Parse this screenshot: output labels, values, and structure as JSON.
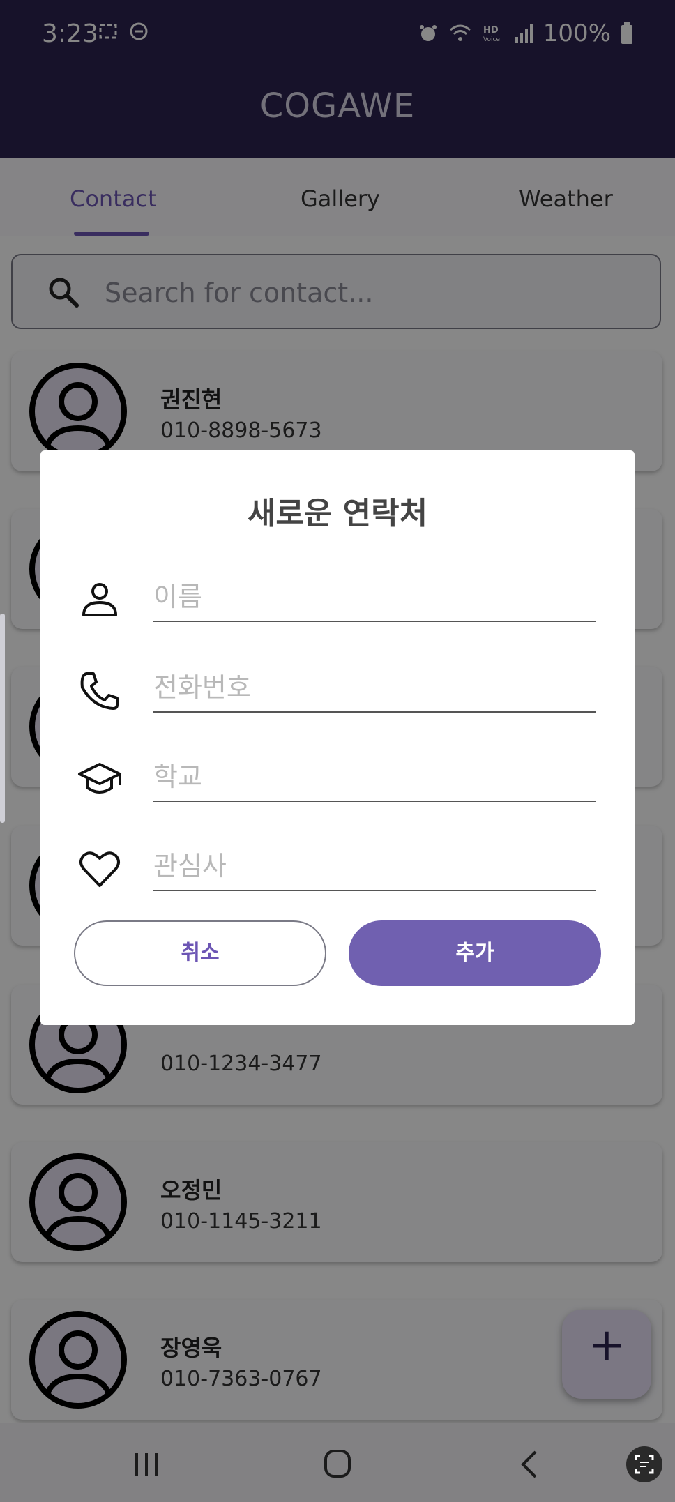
{
  "status_bar": {
    "time": "3:23",
    "battery": "100%"
  },
  "app": {
    "title": "COGAWE"
  },
  "tabs": [
    {
      "label": "Contact",
      "active": true
    },
    {
      "label": "Gallery",
      "active": false
    },
    {
      "label": "Weather",
      "active": false
    }
  ],
  "search": {
    "placeholder": "Search for contact..."
  },
  "contacts": [
    {
      "name": "권진현",
      "phone": "010-8898-5673"
    },
    {
      "name": "",
      "phone": ""
    },
    {
      "name": "",
      "phone": ""
    },
    {
      "name": "",
      "phone": ""
    },
    {
      "name": "",
      "phone": "010-1234-3477"
    },
    {
      "name": "오정민",
      "phone": "010-1145-3211"
    },
    {
      "name": "장영욱",
      "phone": "010-7363-0767"
    }
  ],
  "dialog": {
    "title": "새로운 연락처",
    "fields": [
      {
        "placeholder": "이름",
        "icon": "person-icon"
      },
      {
        "placeholder": "전화번호",
        "icon": "phone-icon"
      },
      {
        "placeholder": "학교",
        "icon": "graduation-cap-icon"
      },
      {
        "placeholder": "관심사",
        "icon": "heart-icon"
      }
    ],
    "cancel_label": "취소",
    "add_label": "추가"
  },
  "fab": {
    "label": "+"
  },
  "colors": {
    "primary_dark": "#2d2250",
    "accent": "#6c55b4",
    "button": "#7060b0"
  }
}
